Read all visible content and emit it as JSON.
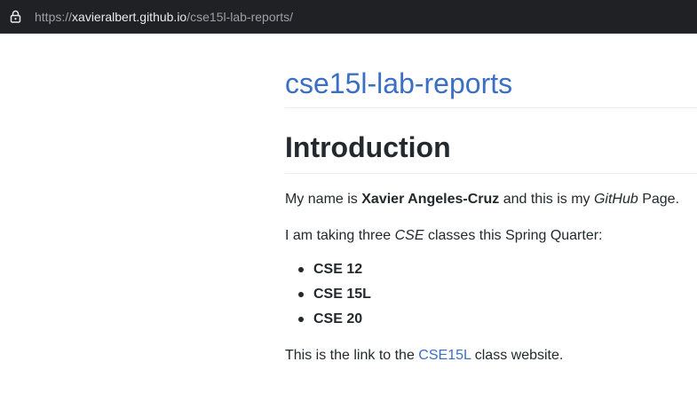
{
  "browser": {
    "url_prefix": "https://",
    "url_host": "xavieralbert.github.io",
    "url_path": "/cse15l-lab-reports/"
  },
  "page": {
    "site_title": "cse15l-lab-reports",
    "heading": "Introduction",
    "intro": {
      "prefix": "My name is ",
      "name": "Xavier Angeles-Cruz",
      "middle": " and this is my ",
      "github": "GitHub",
      "suffix": " Page."
    },
    "classes_intro": {
      "prefix": "I am taking three ",
      "cse": "CSE",
      "suffix": " classes this Spring Quarter:"
    },
    "classes": [
      "CSE 12",
      "CSE 15L",
      "CSE 20"
    ],
    "link_sentence": {
      "prefix": "This is the link to the ",
      "link_text": "CSE15L",
      "suffix": " class website."
    }
  },
  "colors": {
    "link": "#3a6fc4",
    "text": "#24292e",
    "address_bar": "#202124"
  },
  "icons": {
    "lock": "lock-icon"
  }
}
